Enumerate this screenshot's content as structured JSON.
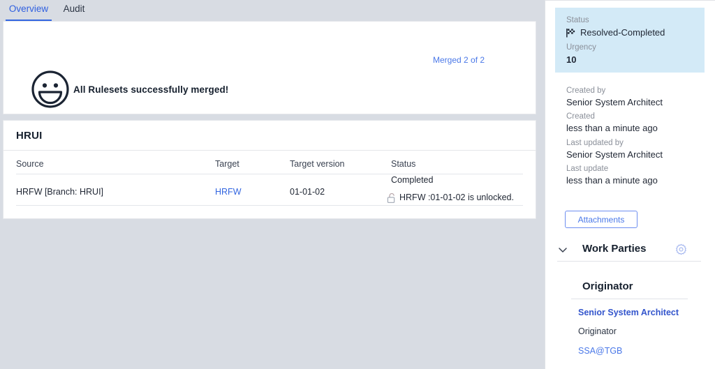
{
  "tabs": [
    {
      "label": "Overview",
      "active": true
    },
    {
      "label": "Audit",
      "active": false
    }
  ],
  "merge_banner": {
    "icon": "smiley-face-icon",
    "message": "All Rulesets successfully merged!"
  },
  "ruleset_card": {
    "title": "HRUI",
    "columns": [
      "Source",
      "Target",
      "Target version",
      "Status"
    ],
    "rows": [
      {
        "source": "HRFW [Branch: HRUI]",
        "target": "HRFW",
        "target_version": "01-01-02",
        "status": "Completed",
        "merged_link": "Merged 2 of 2",
        "lock_icon": "unlock-icon",
        "lock_text": "HRFW :01-01-02 is unlocked."
      }
    ]
  },
  "right_panel": {
    "status_box": {
      "status_label": "Status",
      "status_icon": "checkered-flag-icon",
      "status_value": "Resolved-Completed",
      "urgency_label": "Urgency",
      "urgency_value": "10",
      "background_color": "#d3eaf7"
    },
    "meta": {
      "created_by_label": "Created by",
      "created_by_value": "Senior System Architect",
      "created_label": "Created",
      "created_value": "less than a minute ago",
      "updated_by_label": "Last updated by",
      "updated_by_value": "Senior System Architect",
      "update_label": "Last update",
      "update_value": "less than a minute ago"
    },
    "attachments_label": "Attachments",
    "work_parties": {
      "label": "Work Parties",
      "expanded": true,
      "gear_icon": "gear-icon",
      "chevron_icon": "chevron-down-icon",
      "originator": {
        "title": "Originator",
        "name": "Senior System Architect",
        "role": "Originator",
        "email": "SSA@TGB"
      }
    }
  },
  "colors": {
    "accent": "#3366e0",
    "link": "#4a78e8",
    "status_bg": "#d3eaf7",
    "page_bg": "#d8dce3"
  }
}
